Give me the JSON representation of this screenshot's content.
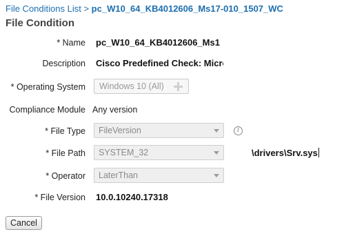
{
  "breadcrumb": {
    "link": "File Conditions List",
    "separator": ">",
    "current": "pc_W10_64_KB4012606_Ms17-010_1507_WC"
  },
  "page_title": "File Condition",
  "fields": {
    "name": {
      "label": "* Name",
      "value": "pc_W10_64_KB4012606_Ms1"
    },
    "description": {
      "label": "Description",
      "value": "Cisco Predefined Check: Micro"
    },
    "operating_system": {
      "label": "* Operating System",
      "value": "Windows 10 (All)",
      "icon": "plus-icon"
    },
    "compliance_module": {
      "label": "Compliance Module",
      "value": "Any version"
    },
    "file_type": {
      "label": "* File Type",
      "value": "FileVersion",
      "icon": "info-icon",
      "info_glyph": "i"
    },
    "file_path": {
      "label": "* File Path",
      "value": "SYSTEM_32",
      "suffix": "\\drivers\\Srv.sys"
    },
    "operator": {
      "label": "* Operator",
      "value": "LaterThan"
    },
    "file_version": {
      "label": "* File Version",
      "value": "10.0.10240.17318"
    }
  },
  "buttons": {
    "cancel": "Cancel"
  },
  "colors": {
    "link": "#1d6fb0",
    "disabled_text": "#8a8a8a",
    "disabled_bg": "#efefef"
  }
}
